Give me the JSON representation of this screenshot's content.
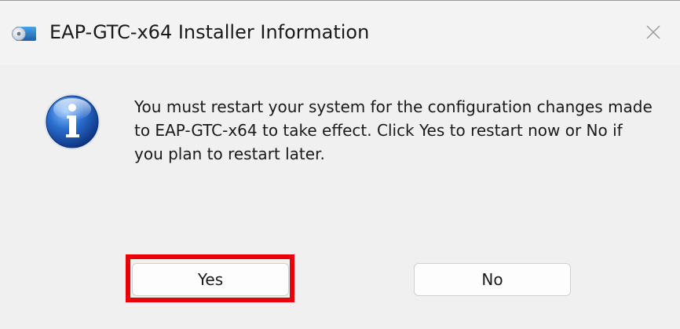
{
  "window": {
    "title": "EAP-GTC-x64 Installer Information",
    "app_icon": "installer-disc-icon",
    "close_icon": "close-icon"
  },
  "dialog": {
    "icon": "info-icon",
    "message": "You must restart your system for the configuration changes made to EAP-GTC-x64 to take effect. Click Yes to restart now or No if you plan to restart later."
  },
  "buttons": {
    "yes_label": "Yes",
    "no_label": "No"
  },
  "annotation": {
    "highlight_target": "yes-button",
    "highlight_color": "#e8000b"
  },
  "colors": {
    "background": "#f0f0f0",
    "info_icon_blue": "#2b6fd0"
  }
}
